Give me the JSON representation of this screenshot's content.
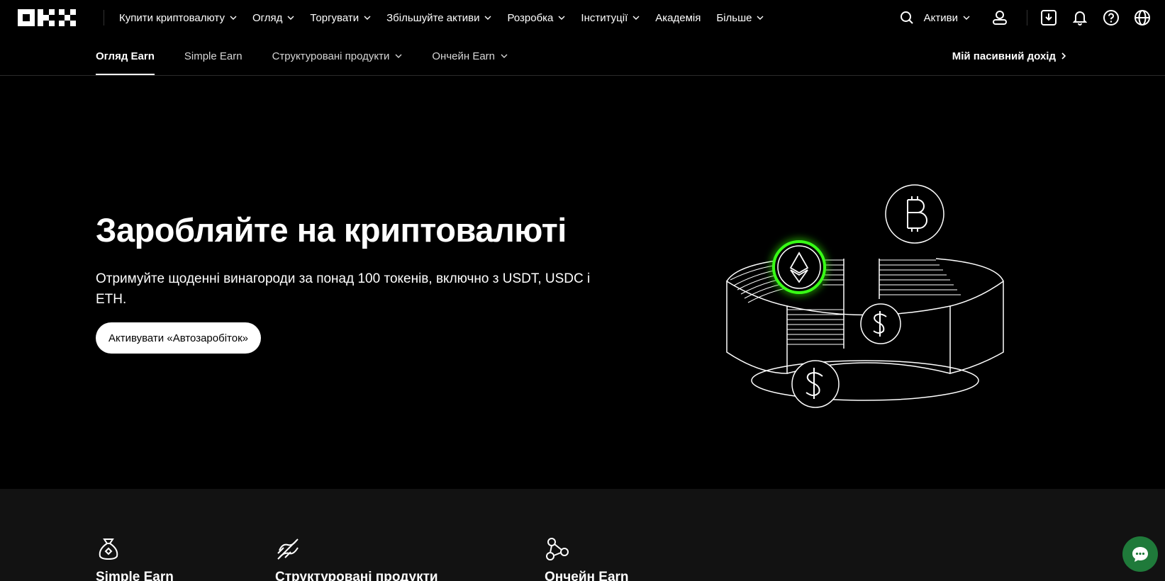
{
  "header": {
    "nav_items": [
      {
        "label": "Купити криптовалюту",
        "has_dropdown": true
      },
      {
        "label": "Огляд",
        "has_dropdown": true
      },
      {
        "label": "Торгувати",
        "has_dropdown": true
      },
      {
        "label": "Збільшуйте активи",
        "has_dropdown": true
      },
      {
        "label": "Розробка",
        "has_dropdown": true
      },
      {
        "label": "Інституції",
        "has_dropdown": true
      },
      {
        "label": "Академія",
        "has_dropdown": false
      },
      {
        "label": "Більше",
        "has_dropdown": true
      }
    ],
    "assets_label": "Активи",
    "icons": [
      "search-icon",
      "user-icon",
      "download-icon",
      "bell-icon",
      "help-icon",
      "globe-icon"
    ]
  },
  "subnav": {
    "tabs": [
      {
        "label": "Огляд Earn",
        "active": true,
        "has_dropdown": false
      },
      {
        "label": "Simple Earn",
        "active": false,
        "has_dropdown": false
      },
      {
        "label": "Структуровані продукти",
        "active": false,
        "has_dropdown": true
      },
      {
        "label": "Ончейн Earn",
        "active": false,
        "has_dropdown": true
      }
    ],
    "passive_income_label": "Мій пасивний дохід"
  },
  "hero": {
    "title": "Заробляйте на криптовалюті",
    "subtitle": "Отримуйте щоденні винагороди за понад 100 токенів, включно з USDT, USDC і ETH.",
    "cta_label": "Активувати «Автозаробіток»"
  },
  "features": [
    {
      "label": "Simple Earn",
      "icon": "money-bag-icon"
    },
    {
      "label": "Структуровані продукти",
      "icon": "structured-products-icon"
    },
    {
      "label": "Ончейн Earn",
      "icon": "onchain-network-icon"
    }
  ],
  "colors": {
    "background": "#000000",
    "accent_green": "#39ff14",
    "bottom_bg": "#121212",
    "chat_button": "#1f7a3a"
  }
}
